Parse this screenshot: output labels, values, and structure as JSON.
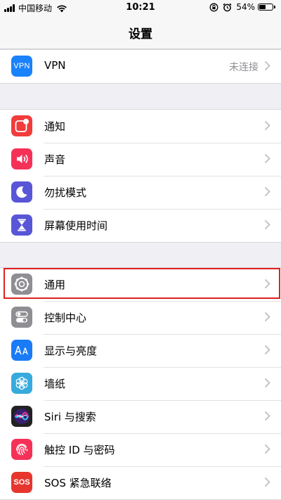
{
  "status_bar": {
    "carrier": "中国移动",
    "time": "10:21",
    "battery_percent": "54%",
    "battery_level": 0.54
  },
  "nav": {
    "title": "设置"
  },
  "groups": [
    {
      "rows": [
        {
          "label": "VPN",
          "value": "未连接",
          "icon": "vpn-icon",
          "color": "#1a82fb"
        }
      ]
    },
    {
      "rows": [
        {
          "label": "通知",
          "icon": "notifications-icon",
          "color": "#f23b3b"
        },
        {
          "label": "声音",
          "icon": "sound-icon",
          "color": "#f53158"
        },
        {
          "label": "勿扰模式",
          "icon": "moon-icon",
          "color": "#5856d6"
        },
        {
          "label": "屏幕使用时间",
          "icon": "hourglass-icon",
          "color": "#5856d6"
        }
      ]
    },
    {
      "rows": [
        {
          "label": "通用",
          "icon": "gear-icon",
          "color": "#8e8e93"
        },
        {
          "label": "控制中心",
          "icon": "toggles-icon",
          "color": "#8e8e93"
        },
        {
          "label": "显示与亮度",
          "icon": "display-brightness-icon",
          "color": "#1a7bf7"
        },
        {
          "label": "墙纸",
          "icon": "wallpaper-flower-icon",
          "color": "#36aadc"
        },
        {
          "label": "Siri 与搜索",
          "icon": "siri-icon",
          "color": "#222222"
        },
        {
          "label": "触控 ID 与密码",
          "icon": "fingerprint-icon",
          "color": "#f53158"
        },
        {
          "label": "SOS 紧急联络",
          "icon": "sos-icon",
          "color": "#e6362e"
        }
      ]
    }
  ],
  "highlight_color": "#e02020"
}
